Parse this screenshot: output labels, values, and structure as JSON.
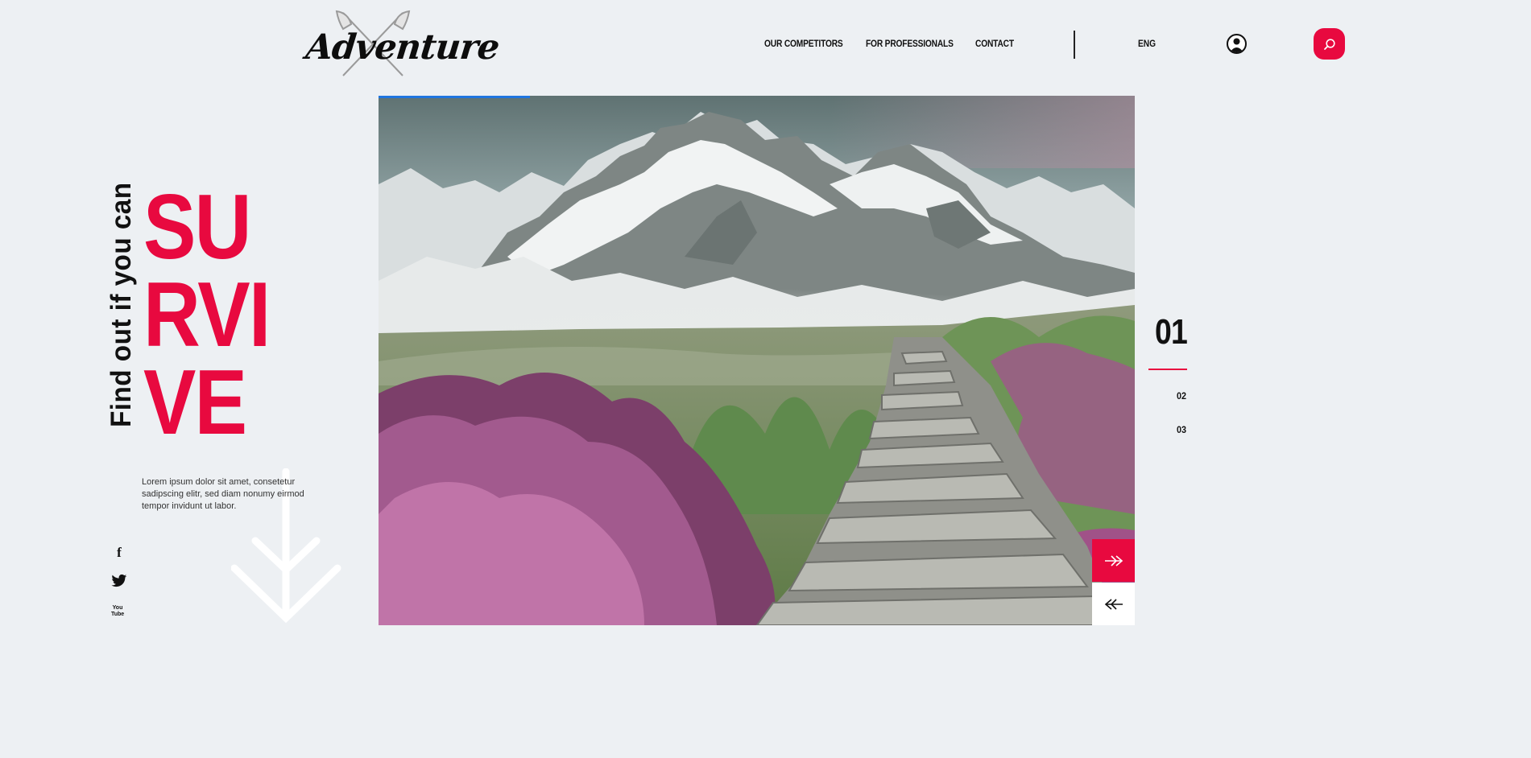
{
  "brand": {
    "logo_text": "Adventure"
  },
  "nav": {
    "items": [
      {
        "label": "OUR COMPETITORS"
      },
      {
        "label": "FOR PROFESSIONALS"
      },
      {
        "label": "CONTACT"
      }
    ],
    "language": "ENG"
  },
  "hero": {
    "tagline": "Find out if you can",
    "headline_lines": [
      "SU",
      "RVI",
      "VE"
    ],
    "intro": "Lorem ipsum dolor sit amet, consetetur sadipscing elitr, sed diam nonumy eirmod tempor invidunt ut labor.",
    "slide_progress": 0.2
  },
  "social": [
    {
      "icon": "facebook-icon",
      "glyph": "f"
    },
    {
      "icon": "twitter-icon",
      "glyph": "🐦"
    },
    {
      "icon": "youtube-icon",
      "glyph": "You Tube"
    }
  ],
  "slider": {
    "current": "01",
    "others": [
      "02",
      "03"
    ]
  },
  "colors": {
    "accent": "#e8093f",
    "background": "#edf0f3",
    "progress": "#1f75e0"
  }
}
